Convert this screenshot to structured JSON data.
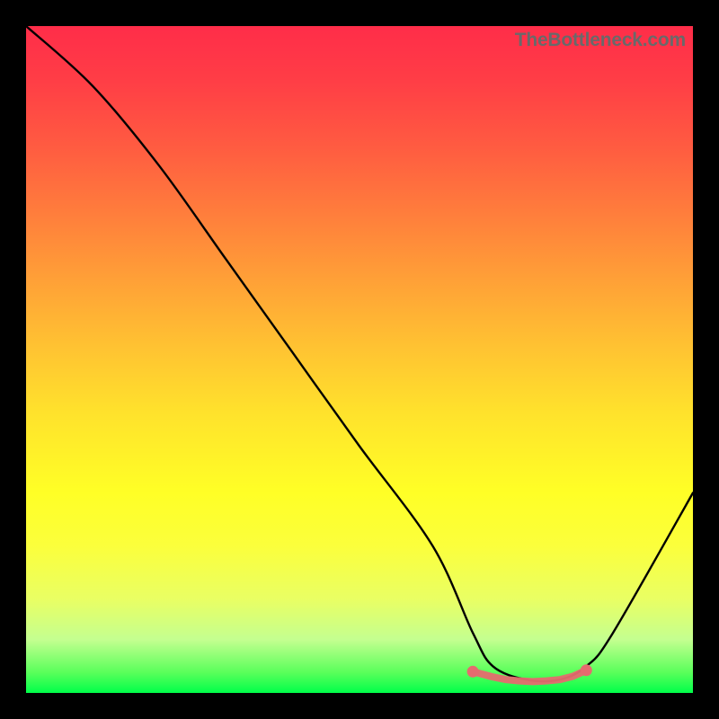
{
  "watermark": "TheBottleneck.com",
  "chart_data": {
    "type": "line",
    "title": "",
    "xlabel": "",
    "ylabel": "",
    "xlim": [
      0,
      100
    ],
    "ylim": [
      0,
      100
    ],
    "series": [
      {
        "name": "bottleneck-curve",
        "x": [
          0,
          10,
          20,
          30,
          40,
          50,
          61,
          67,
          70,
          75,
          80,
          84,
          88,
          100
        ],
        "y": [
          100,
          91,
          79,
          65,
          51,
          37,
          22,
          9,
          4,
          2,
          2,
          4,
          9,
          30
        ]
      },
      {
        "name": "optimal-range-markers",
        "x": [
          67,
          70,
          72,
          74,
          76,
          78,
          80,
          82,
          84
        ],
        "y": [
          3.2,
          2.4,
          2.0,
          1.8,
          1.7,
          1.8,
          2.0,
          2.5,
          3.4
        ]
      }
    ],
    "colors": {
      "curve": "#000000",
      "markers": "#e56b6f",
      "gradient_top": "#ff2d49",
      "gradient_bottom": "#00ff4a"
    }
  }
}
